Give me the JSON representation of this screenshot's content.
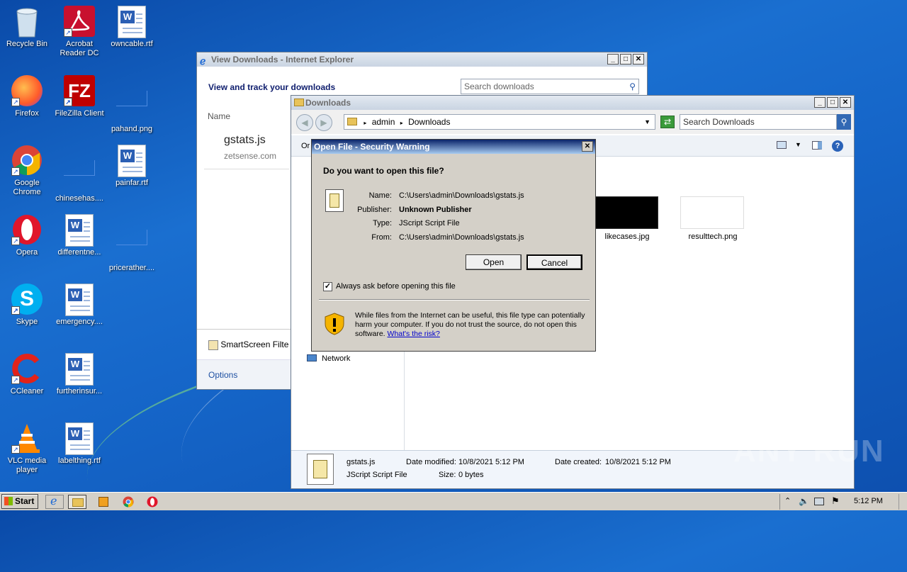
{
  "desktop": {
    "icons": [
      {
        "label": "Recycle Bin",
        "icon": "recycle-bin-icon"
      },
      {
        "label": "Acrobat Reader DC",
        "icon": "acrobat-icon"
      },
      {
        "label": "owncable.rtf",
        "icon": "word-doc-icon"
      },
      {
        "label": "Firefox",
        "icon": "firefox-icon"
      },
      {
        "label": "FileZilla Client",
        "icon": "filezilla-icon"
      },
      {
        "label": "pahand.png",
        "icon": "image-file-icon"
      },
      {
        "label": "Google Chrome",
        "icon": "chrome-icon"
      },
      {
        "label": "chinesehas....",
        "icon": "image-file-icon"
      },
      {
        "label": "painfar.rtf",
        "icon": "word-doc-icon"
      },
      {
        "label": "Opera",
        "icon": "opera-icon"
      },
      {
        "label": "differentne...",
        "icon": "word-doc-icon"
      },
      {
        "label": "pricerather....",
        "icon": "image-file-icon"
      },
      {
        "label": "Skype",
        "icon": "skype-icon"
      },
      {
        "label": "emergency....",
        "icon": "word-doc-icon"
      },
      {
        "label": "CCleaner",
        "icon": "ccleaner-icon"
      },
      {
        "label": "furtherinsur...",
        "icon": "word-doc-icon"
      },
      {
        "label": "VLC media player",
        "icon": "vlc-icon"
      },
      {
        "label": "labelthing.rtf",
        "icon": "word-doc-icon"
      }
    ]
  },
  "ie_window": {
    "title": "View Downloads - Internet Explorer",
    "heading": "View and track your downloads",
    "search_placeholder": "Search downloads",
    "col_name": "Name",
    "file_name": "gstats.js",
    "file_source": "zetsense.com",
    "smartscreen": "SmartScreen Filte",
    "options": "Options"
  },
  "explorer": {
    "title": "Downloads",
    "path": [
      "admin",
      "Downloads"
    ],
    "search_placeholder": "Search Downloads",
    "org_label": "Or",
    "nav_network": "Network",
    "files": [
      {
        "name": "likecases.jpg"
      },
      {
        "name": "resulttech.png"
      }
    ],
    "details": {
      "name": "gstats.js",
      "type": "JScript Script File",
      "modified_label": "Date modified:",
      "modified": "10/8/2021 5:12 PM",
      "size_label": "Size:",
      "size": "0 bytes",
      "created_label": "Date created:",
      "created": "10/8/2021 5:12 PM"
    }
  },
  "dialog": {
    "title": "Open File - Security Warning",
    "question": "Do you want to open this file?",
    "name_label": "Name:",
    "name": "C:\\Users\\admin\\Downloads\\gstats.js",
    "publisher_label": "Publisher:",
    "publisher": "Unknown Publisher",
    "type_label": "Type:",
    "type": "JScript Script File",
    "from_label": "From:",
    "from": "C:\\Users\\admin\\Downloads\\gstats.js",
    "open": "Open",
    "cancel": "Cancel",
    "always_ask": "Always ask before opening this file",
    "always_ask_checked": true,
    "warning": "While files from the Internet can be useful, this file type can potentially harm your computer. If you do not trust the source, do not open this software.",
    "risk_link": "What's the risk?"
  },
  "taskbar": {
    "start": "Start",
    "clock": "5:12 PM"
  },
  "watermark": "ANY RUN"
}
